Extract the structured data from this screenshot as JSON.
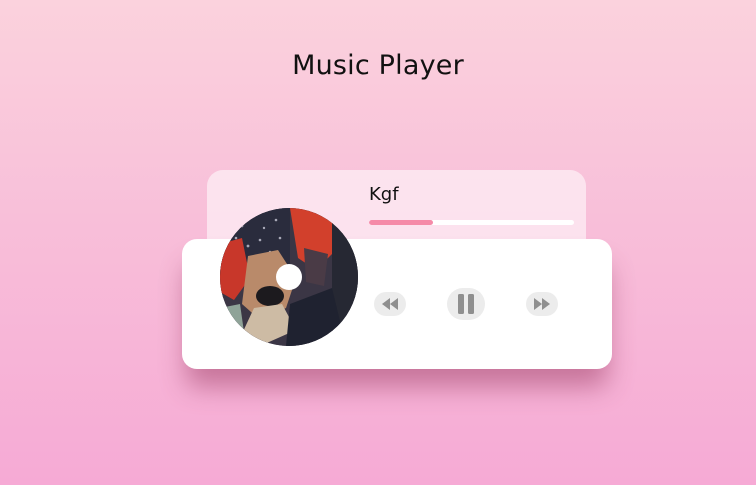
{
  "app": {
    "title": "Music Player"
  },
  "track": {
    "name": "Kgf",
    "progress": 0.31,
    "state": "playing"
  },
  "controls": {
    "previous_icon": "rewind-icon",
    "play_pause_icon": "pause-icon",
    "next_icon": "fast-forward-icon"
  },
  "colors": {
    "background_top": "#fbd2dd",
    "background_bottom": "#f6aad5",
    "progress_fill": "#f58aa8",
    "card": "#ffffff",
    "control_icon": "#8f8f8f"
  }
}
